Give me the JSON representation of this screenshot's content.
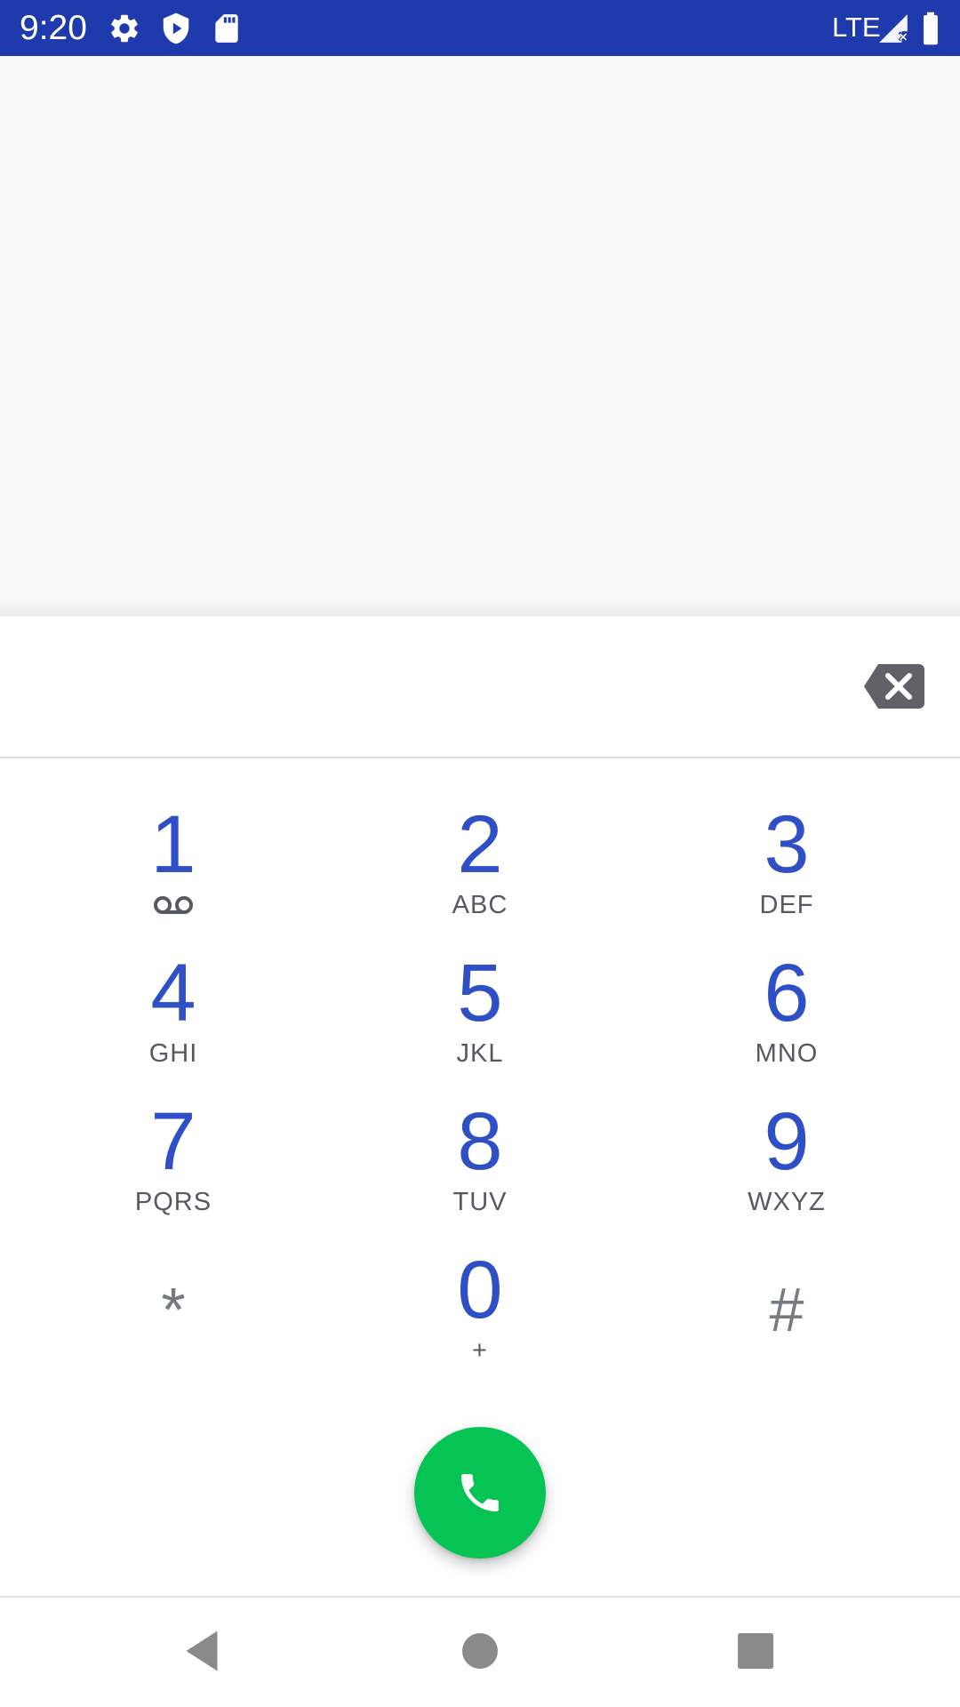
{
  "status_bar": {
    "time": "9:20",
    "network": "LTE",
    "icons": [
      "gear-icon",
      "play-protect-icon",
      "sd-card-icon",
      "signal-icon",
      "battery-icon"
    ],
    "color": "#1e3aad"
  },
  "dialer": {
    "digits_value": "",
    "backspace_icon": "backspace-icon",
    "keys": [
      {
        "digit": "1",
        "letters": "",
        "sub_icon": "voicemail-icon"
      },
      {
        "digit": "2",
        "letters": "ABC"
      },
      {
        "digit": "3",
        "letters": "DEF"
      },
      {
        "digit": "4",
        "letters": "GHI"
      },
      {
        "digit": "5",
        "letters": "JKL"
      },
      {
        "digit": "6",
        "letters": "MNO"
      },
      {
        "digit": "7",
        "letters": "PQRS"
      },
      {
        "digit": "8",
        "letters": "TUV"
      },
      {
        "digit": "9",
        "letters": "WXYZ"
      },
      {
        "digit": "*",
        "letters": ""
      },
      {
        "digit": "0",
        "letters": "+"
      },
      {
        "digit": "#",
        "letters": ""
      }
    ],
    "call_button_icon": "phone-icon",
    "accent_color": "#2f4fc7",
    "call_color": "#05c454"
  },
  "nav_bar": {
    "icons": [
      "back-icon",
      "home-icon",
      "recents-icon"
    ]
  }
}
